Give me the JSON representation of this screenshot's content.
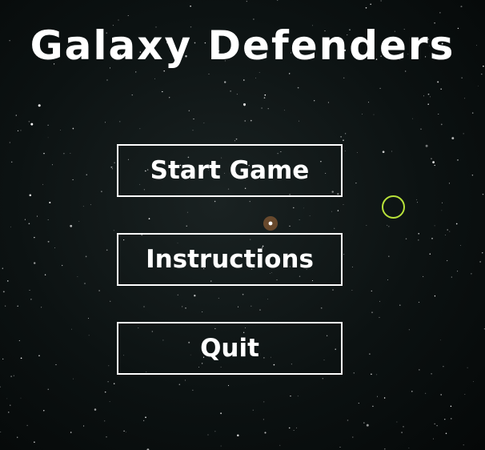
{
  "title": "Galaxy Defenders",
  "menu": {
    "start_label": "Start Game",
    "instructions_label": "Instructions",
    "quit_label": "Quit"
  },
  "colors": {
    "text": "#ffffff",
    "button_border": "#ffffff",
    "cursor_ring": "#b8e23a",
    "glowing_star": "#ff9a4a"
  },
  "icons": {
    "cursor": "cursor-ring-icon"
  }
}
